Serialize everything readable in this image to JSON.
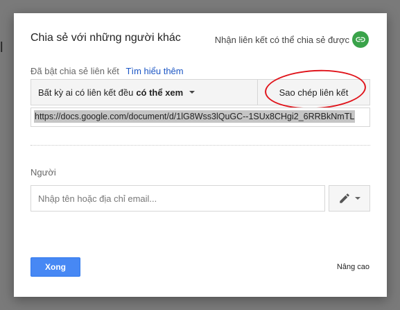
{
  "background": {
    "glyph": "l"
  },
  "dialog": {
    "title": "Chia sẻ với những người khác",
    "get_link_label": "Nhận liên kết có thể chia sẻ được",
    "get_link_icon": "link-icon",
    "link_status": "Đã bật chia sẻ liên kết",
    "learn_more": "Tìm hiểu thêm",
    "access": {
      "prefix": "Bất kỳ ai có liên kết đều",
      "level": "có thể xem"
    },
    "copy_link_label": "Sao chép liên kết",
    "url": "https://docs.google.com/document/d/1lG8Wss3lQuGC--1SUx8CHgi2_6RRBkNmTL",
    "people_label": "Người",
    "email_placeholder": "Nhập tên hoặc địa chỉ email...",
    "permission_icon": "pencil-icon",
    "done_label": "Xong",
    "advanced_label": "Nâng cao"
  },
  "colors": {
    "link_icon_bg": "#3aa34a",
    "primary_button": "#4788f4",
    "learn_more_link": "#1a55c4",
    "annotation_circle": "#e0141b"
  }
}
